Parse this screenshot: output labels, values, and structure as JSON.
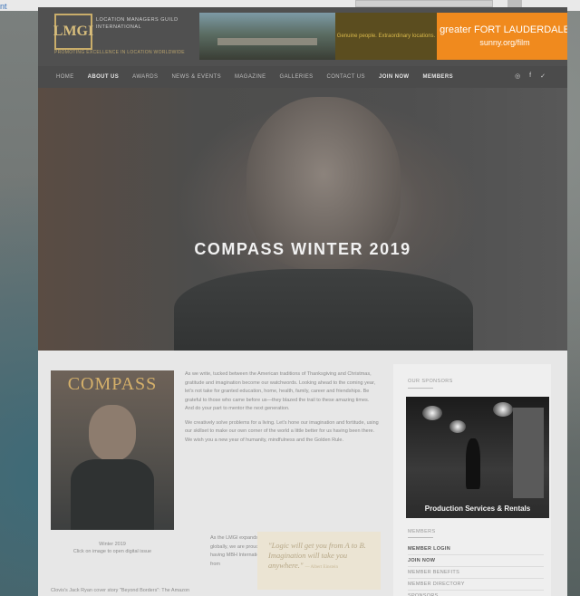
{
  "outer": {
    "link_text": "nt"
  },
  "header": {
    "logo_mark": "LMGI",
    "logo_name": "LOCATION MANAGERS GUILD INTERNATIONAL",
    "logo_tagline": "PROMOTING EXCELLENCE IN LOCATION WORLDWIDE"
  },
  "ad_banner": {
    "middle_text": "Genuine people. Extraordinary locations.",
    "right_line1": "greater FORT LAUDERDALE",
    "right_line2": "sunny.org/film"
  },
  "nav": {
    "items": [
      {
        "label": "HOME",
        "bold": false
      },
      {
        "label": "ABOUT US",
        "bold": true
      },
      {
        "label": "AWARDS",
        "bold": false
      },
      {
        "label": "NEWS & EVENTS",
        "bold": false
      },
      {
        "label": "MAGAZINE",
        "bold": false
      },
      {
        "label": "GALLERIES",
        "bold": false
      },
      {
        "label": "CONTACT US",
        "bold": false
      },
      {
        "label": "JOIN NOW",
        "bold": true
      },
      {
        "label": "MEMBERS",
        "bold": true
      }
    ],
    "social": [
      "instagram-icon",
      "facebook-icon",
      "twitter-icon"
    ],
    "social_glyphs": [
      "◎",
      "f",
      "✓"
    ]
  },
  "hero": {
    "title": "COMPASS WINTER 2019"
  },
  "cover": {
    "title": "COMPASS",
    "caption_line1": "Winter 2019",
    "caption_line2": "Click on image to open digital issue",
    "caption_bottom": "Clovis's Jack Ryan cover story \"Beyond Borders\": The Amazon"
  },
  "article": {
    "para1": "As we write, tucked between the American traditions of Thanksgiving and Christmas, gratitude and imagination become our watchwords. Looking ahead to the coming year, let's not take for granted education, home, health, family, career and friendships. Be grateful to those who came before us—they blazed the trail to these amazing times. And do your part to mentor the next generation.",
    "para2": "We creatively solve problems for a living. Let's hone our imagination and fortitude, using our skillset to make our own corner of the world a little better for us having been there. We wish you a new year of humanity, mindfulness and the Golden Rule.",
    "para3": "As the LMGI expands globally, we are proud of having MBH International from"
  },
  "quote": {
    "text": "\"Logic will get you from A to B. Imagination will take you anywhere.\"",
    "attribution": "— Albert Einstein"
  },
  "sidebar": {
    "sponsors_heading": "OUR SPONSORS",
    "sponsor_ad_label": "Production Services & Rentals",
    "members_heading": "MEMBERS",
    "member_links": [
      {
        "label": "MEMBER LOGIN",
        "strong": true
      },
      {
        "label": "JOIN NOW",
        "strong": true
      },
      {
        "label": "MEMBER BENEFITS",
        "strong": false
      },
      {
        "label": "MEMBER DIRECTORY",
        "strong": false
      },
      {
        "label": "SPONSORS",
        "strong": false
      }
    ]
  }
}
